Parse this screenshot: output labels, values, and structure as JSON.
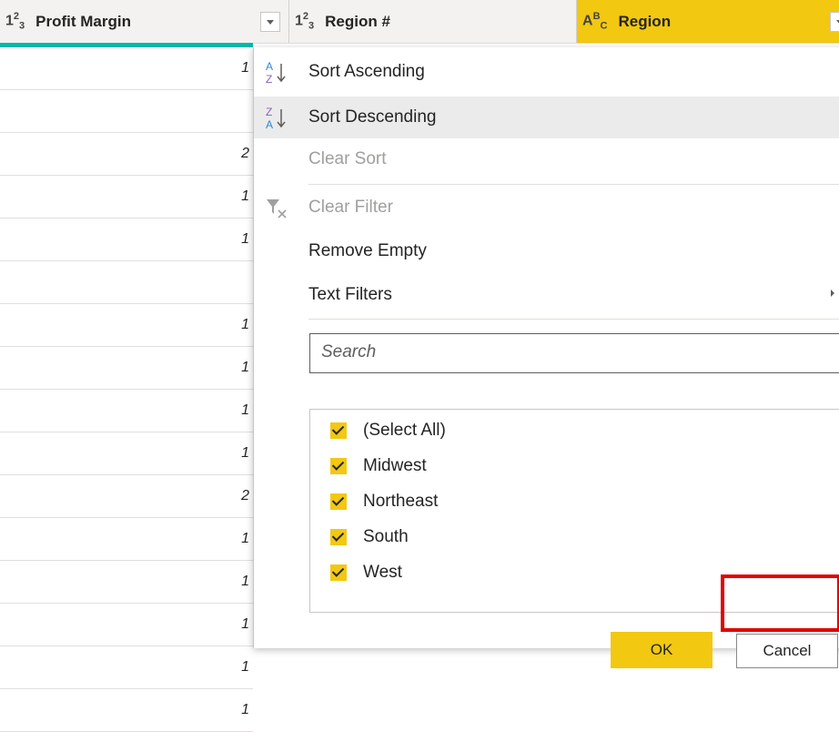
{
  "columns": [
    {
      "type_icon": "1²₃",
      "title": "Profit Margin"
    },
    {
      "type_icon": "1²₃",
      "title": "Region #"
    },
    {
      "type_icon": "AᴮC",
      "title": "Region"
    }
  ],
  "rows": [
    "1",
    "",
    "2",
    "1",
    "1",
    "",
    "1",
    "1",
    "1",
    "1",
    "2",
    "1",
    "1",
    "1",
    "1",
    "1"
  ],
  "menu": {
    "sort_ascending": "Sort Ascending",
    "sort_descending": "Sort Descending",
    "clear_sort": "Clear Sort",
    "clear_filter": "Clear Filter",
    "remove_empty": "Remove Empty",
    "text_filters": "Text Filters"
  },
  "search": {
    "placeholder": "Search"
  },
  "filter_items": [
    {
      "label": "(Select All)",
      "checked": true
    },
    {
      "label": "Midwest",
      "checked": true
    },
    {
      "label": "Northeast",
      "checked": true
    },
    {
      "label": "South",
      "checked": true
    },
    {
      "label": "West",
      "checked": true
    }
  ],
  "buttons": {
    "ok": "OK",
    "cancel": "Cancel"
  },
  "colors": {
    "accent": "#f2c811",
    "quality_bar": "#01b8aa",
    "highlight": "#e00000"
  }
}
